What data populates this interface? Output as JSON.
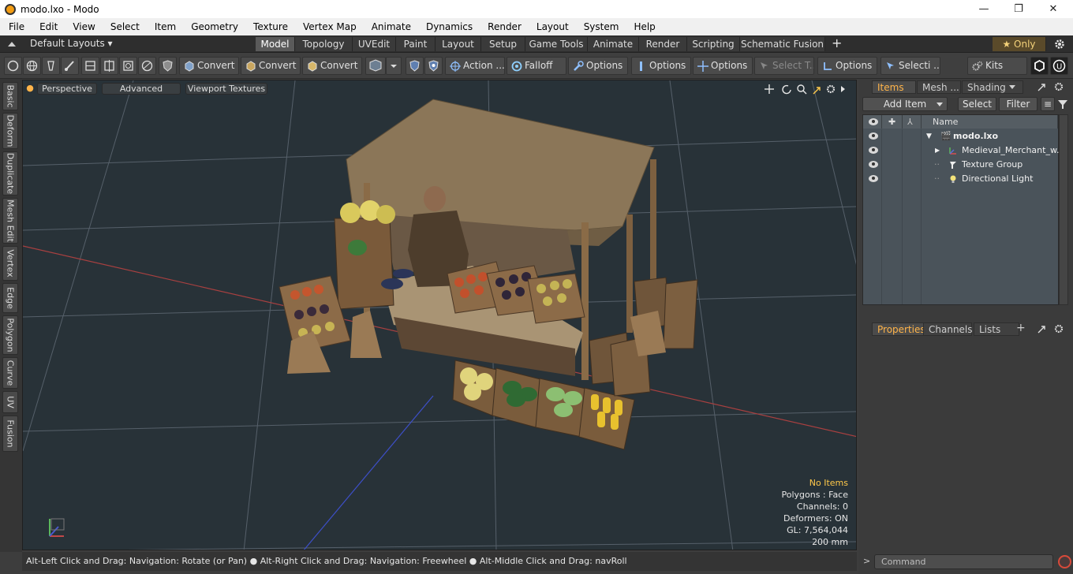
{
  "window": {
    "title": "modo.lxo - Modo",
    "minimize": "—",
    "maximize": "❐",
    "close": "✕"
  },
  "menu": [
    "File",
    "Edit",
    "View",
    "Select",
    "Item",
    "Geometry",
    "Texture",
    "Vertex Map",
    "Animate",
    "Dynamics",
    "Render",
    "Layout",
    "System",
    "Help"
  ],
  "layout_bar": {
    "layouts_label": "Default Layouts ▾",
    "tabs": [
      "Model",
      "Topology",
      "UVEdit",
      "Paint",
      "Layout",
      "Setup",
      "Game Tools",
      "Animate",
      "Render",
      "Scripting",
      "Schematic Fusion"
    ],
    "active_tab": "Model",
    "add": "+",
    "only_label": "★  Only",
    "settings_icon": "gear-icon"
  },
  "toolbar": {
    "convert1": "Convert",
    "convert2": "Convert",
    "convert3": "Convert",
    "action": "Action ...",
    "falloff": "Falloff",
    "options1": "Options",
    "options2": "Options",
    "options3": "Options",
    "select_t": "Select T...",
    "options4": "Options",
    "selecti": "Selecti ...",
    "kits": "Kits"
  },
  "left_tabs": [
    "Basic",
    "Deform",
    "Duplicate",
    "Mesh Edit",
    "Vertex",
    "Edge",
    "Polygon",
    "Curve",
    "UV",
    "Fusion"
  ],
  "viewport": {
    "tabs": [
      "Perspective",
      "Advanced",
      "Viewport Textures"
    ],
    "stats": {
      "items": "No Items",
      "polygons": "Polygons : Face",
      "channels": "Channels: 0",
      "deformers": "Deformers: ON",
      "gl": "GL: 7,564,044",
      "scale": "200 mm"
    },
    "colors": {
      "background": "#283238",
      "grid": "#5b6469",
      "x_axis": "#b03c3c",
      "z_axis": "#3c4fd0",
      "highlight": "#ffc94a"
    }
  },
  "status_bar": "Alt-Left Click and Drag: Navigation: Rotate (or Pan) ● Alt-Right Click and Drag: Navigation: Freewheel ● Alt-Middle Click and Drag: navRoll",
  "right_panel": {
    "tabs": [
      "Items",
      "Mesh ...",
      "Shading"
    ],
    "active_tab": "Items",
    "add_item": "Add Item",
    "select": "Select",
    "filter": "Filter",
    "column_name": "Name",
    "items": [
      {
        "name": "modo.lxo",
        "bold": true
      },
      {
        "name": "Medieval_Merchant_w..."
      },
      {
        "name": "Texture Group"
      },
      {
        "name": "Directional Light"
      }
    ],
    "bottom_tabs": [
      "Properties",
      "Channels",
      "Lists"
    ],
    "active_bottom_tab": "Properties",
    "command_placeholder": "Command",
    "prompt": ">"
  }
}
